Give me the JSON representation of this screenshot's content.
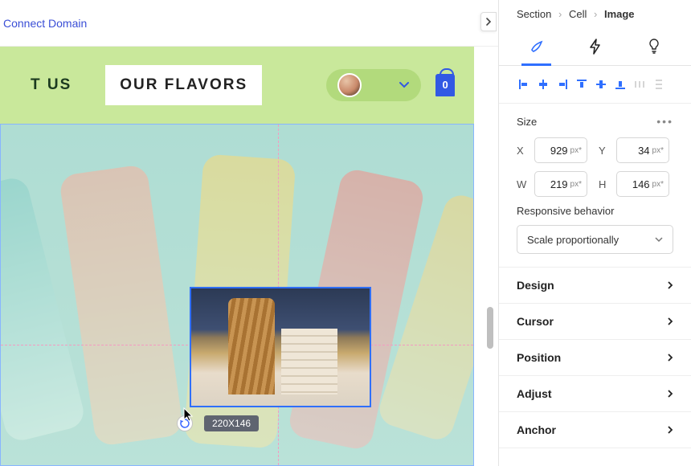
{
  "top_link": "Connect Domain",
  "nav": {
    "about": "T US",
    "flavors": "OUR FLAVORS",
    "bag_count": "0"
  },
  "selection": {
    "size_label": "220X146"
  },
  "panel": {
    "breadcrumb": [
      "Section",
      "Cell",
      "Image"
    ],
    "size": {
      "heading": "Size",
      "x": {
        "label": "X",
        "value": "929",
        "unit": "px*"
      },
      "y": {
        "label": "Y",
        "value": "34",
        "unit": "px*"
      },
      "w": {
        "label": "W",
        "value": "219",
        "unit": "px*"
      },
      "h": {
        "label": "H",
        "value": "146",
        "unit": "px*"
      }
    },
    "responsive": {
      "label": "Responsive behavior",
      "value": "Scale proportionally"
    },
    "accordion": [
      "Design",
      "Cursor",
      "Position",
      "Adjust",
      "Anchor"
    ]
  }
}
